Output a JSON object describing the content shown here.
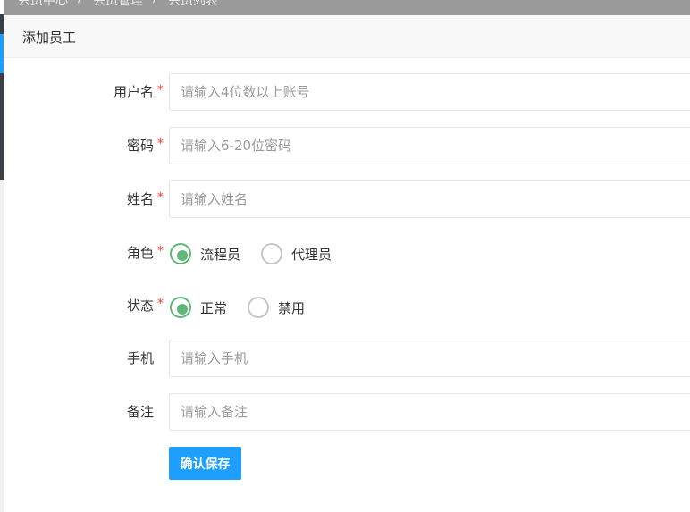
{
  "breadcrumb": {
    "items": [
      "会员中心",
      "会员管理",
      "会员列表"
    ]
  },
  "card": {
    "title": "添加员工"
  },
  "form": {
    "required_mark": "*",
    "username": {
      "label": "用户名",
      "placeholder": "请输入4位数以上账号",
      "value": ""
    },
    "password": {
      "label": "密码",
      "placeholder": "请输入6-20位密码",
      "value": ""
    },
    "name": {
      "label": "姓名",
      "placeholder": "请输入姓名",
      "value": ""
    },
    "role": {
      "label": "角色",
      "options": [
        "流程员",
        "代理员"
      ],
      "selected": "流程员"
    },
    "status": {
      "label": "状态",
      "options": [
        "正常",
        "禁用"
      ],
      "selected": "正常"
    },
    "phone": {
      "label": "手机",
      "placeholder": "请输入手机",
      "value": ""
    },
    "remark": {
      "label": "备注",
      "placeholder": "请输入备注",
      "value": ""
    },
    "save_label": "确认保存"
  },
  "colors": {
    "accent": "#1e9fff",
    "radio_checked": "#5fb878",
    "required": "#ff3b30"
  }
}
